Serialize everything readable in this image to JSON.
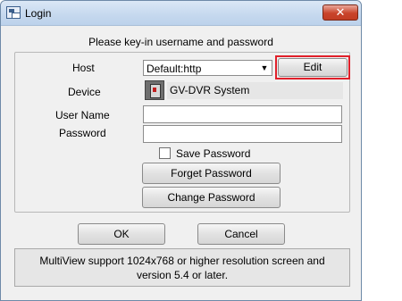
{
  "window": {
    "title": "Login",
    "close_glyph": "✕"
  },
  "header": {
    "prompt": "Please key-in username and password"
  },
  "form": {
    "host_label": "Host",
    "host_value": "Default:http",
    "edit_label": "Edit",
    "device_label": "Device",
    "device_value": "GV-DVR System",
    "username_label": "User Name",
    "username_value": "",
    "password_label": "Password",
    "password_value": "",
    "save_password_label": "Save Password",
    "save_password_checked": false,
    "forget_password_label": "Forget Password",
    "change_password_label": "Change Password"
  },
  "actions": {
    "ok_label": "OK",
    "cancel_label": "Cancel"
  },
  "info": {
    "line1": "MultiView support 1024x768 or higher resolution screen and",
    "line2": "version 5.4 or later."
  },
  "colors": {
    "highlight": "#e0202a",
    "titlebar": "#c5d8ee",
    "close": "#c9442b"
  },
  "icons": {
    "app": "login-window-icon",
    "device": "dvr-device-icon",
    "dropdown": "chevron-down-icon"
  }
}
